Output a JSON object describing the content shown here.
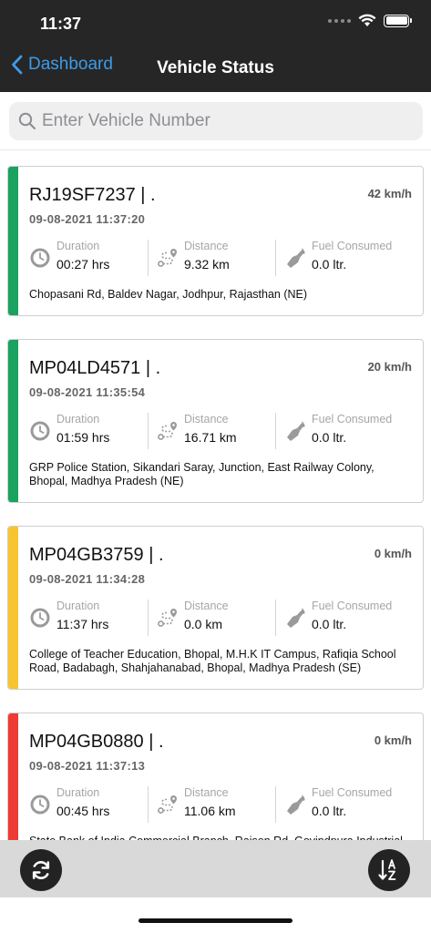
{
  "status_bar": {
    "time": "11:37"
  },
  "nav": {
    "back_label": "Dashboard",
    "title": "Vehicle Status"
  },
  "search": {
    "placeholder": "Enter Vehicle Number",
    "value": ""
  },
  "metric_labels": {
    "duration": "Duration",
    "distance": "Distance",
    "fuel": "Fuel Consumed"
  },
  "colors": {
    "green": "#1aa260",
    "yellow": "#f7c430",
    "red": "#ee3b34",
    "link": "#3d9be9",
    "header": "#262626"
  },
  "vehicles": [
    {
      "number": "RJ19SF7237 | .",
      "speed": "42 km/h",
      "timestamp": "09-08-2021 11:37:20",
      "duration": "00:27 hrs",
      "distance": "9.32 km",
      "fuel": "0.0 ltr.",
      "address": "Chopasani Rd, Baldev Nagar, Jodhpur, Rajasthan (NE)",
      "status_color": "#1aa260"
    },
    {
      "number": "MP04LD4571 | .",
      "speed": "20 km/h",
      "timestamp": "09-08-2021 11:35:54",
      "duration": "01:59 hrs",
      "distance": "16.71 km",
      "fuel": "0.0 ltr.",
      "address": "GRP Police Station, Sikandari Saray, Junction, East Railway Colony, Bhopal, Madhya Pradesh (NE)",
      "status_color": "#1aa260"
    },
    {
      "number": "MP04GB3759 | .",
      "speed": "0 km/h",
      "timestamp": "09-08-2021 11:34:28",
      "duration": "11:37 hrs",
      "distance": "0.0 km",
      "fuel": "0.0 ltr.",
      "address": "College of Teacher Education, Bhopal, M.H.K IT Campus, Rafiqia School Road, Badabagh, Shahjahanabad, Bhopal, Madhya Pradesh (SE)",
      "status_color": "#f7c430"
    },
    {
      "number": "MP04GB0880 | .",
      "speed": "0 km/h",
      "timestamp": "09-08-2021 11:37:13",
      "duration": "00:45 hrs",
      "distance": "11.06 km",
      "fuel": "0.0 ltr.",
      "address": "State Bank of India Commercial Branch, Raisen Rd, Govindpura Industrial",
      "status_color": "#ee3b34"
    }
  ],
  "icons": {
    "refresh": "refresh-icon",
    "sort": "sort-az-icon"
  }
}
